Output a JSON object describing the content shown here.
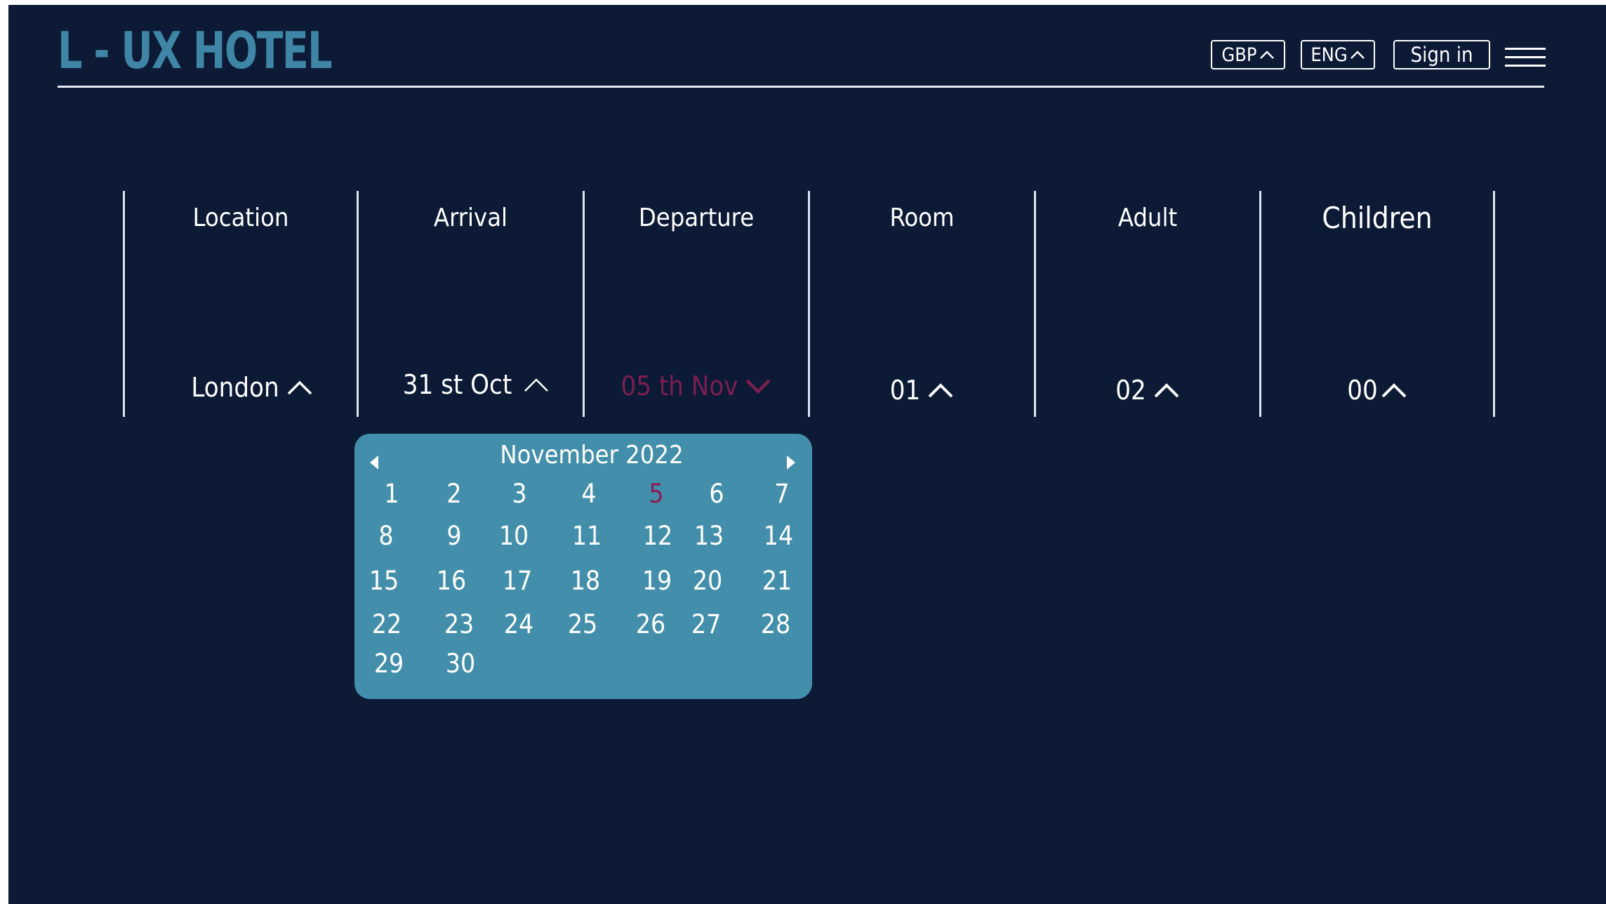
{
  "header": {
    "logo": "L - UX HOTEL",
    "currency_label": "GBP",
    "language_label": "ENG",
    "signin_label": "Sign in"
  },
  "booking": {
    "location": {
      "label": "Location",
      "value": "London"
    },
    "arrival": {
      "label": "Arrival",
      "value": "31 st  Oct"
    },
    "departure": {
      "label": "Departure",
      "value": "05 th Nov"
    },
    "room": {
      "label": "Room",
      "value": "01"
    },
    "adult": {
      "label": "Adult",
      "value": "02"
    },
    "children": {
      "label": "Children",
      "value": "00"
    }
  },
  "calendar": {
    "month_label": "November  2022",
    "selected_day": "5",
    "days": [
      "1",
      "2",
      "3",
      "4",
      "5",
      "6",
      "7",
      "8",
      "9",
      "10",
      "11",
      "12",
      "13",
      "14",
      "15",
      "16",
      "17",
      "18",
      "19",
      "20",
      "21",
      "22",
      "23",
      "24",
      "25",
      "26",
      "27",
      "28",
      "29",
      "30"
    ]
  },
  "colors": {
    "background": "#0c1a36",
    "brand": "#3f86a6",
    "calendar_bg": "#438fab",
    "accent": "#8a1d54"
  },
  "icons": {
    "expand": "chevron-up-icon",
    "collapse": "chevron-down-icon",
    "menu": "hamburger-menu-icon",
    "prev": "caret-left-icon",
    "next": "caret-right-icon"
  }
}
